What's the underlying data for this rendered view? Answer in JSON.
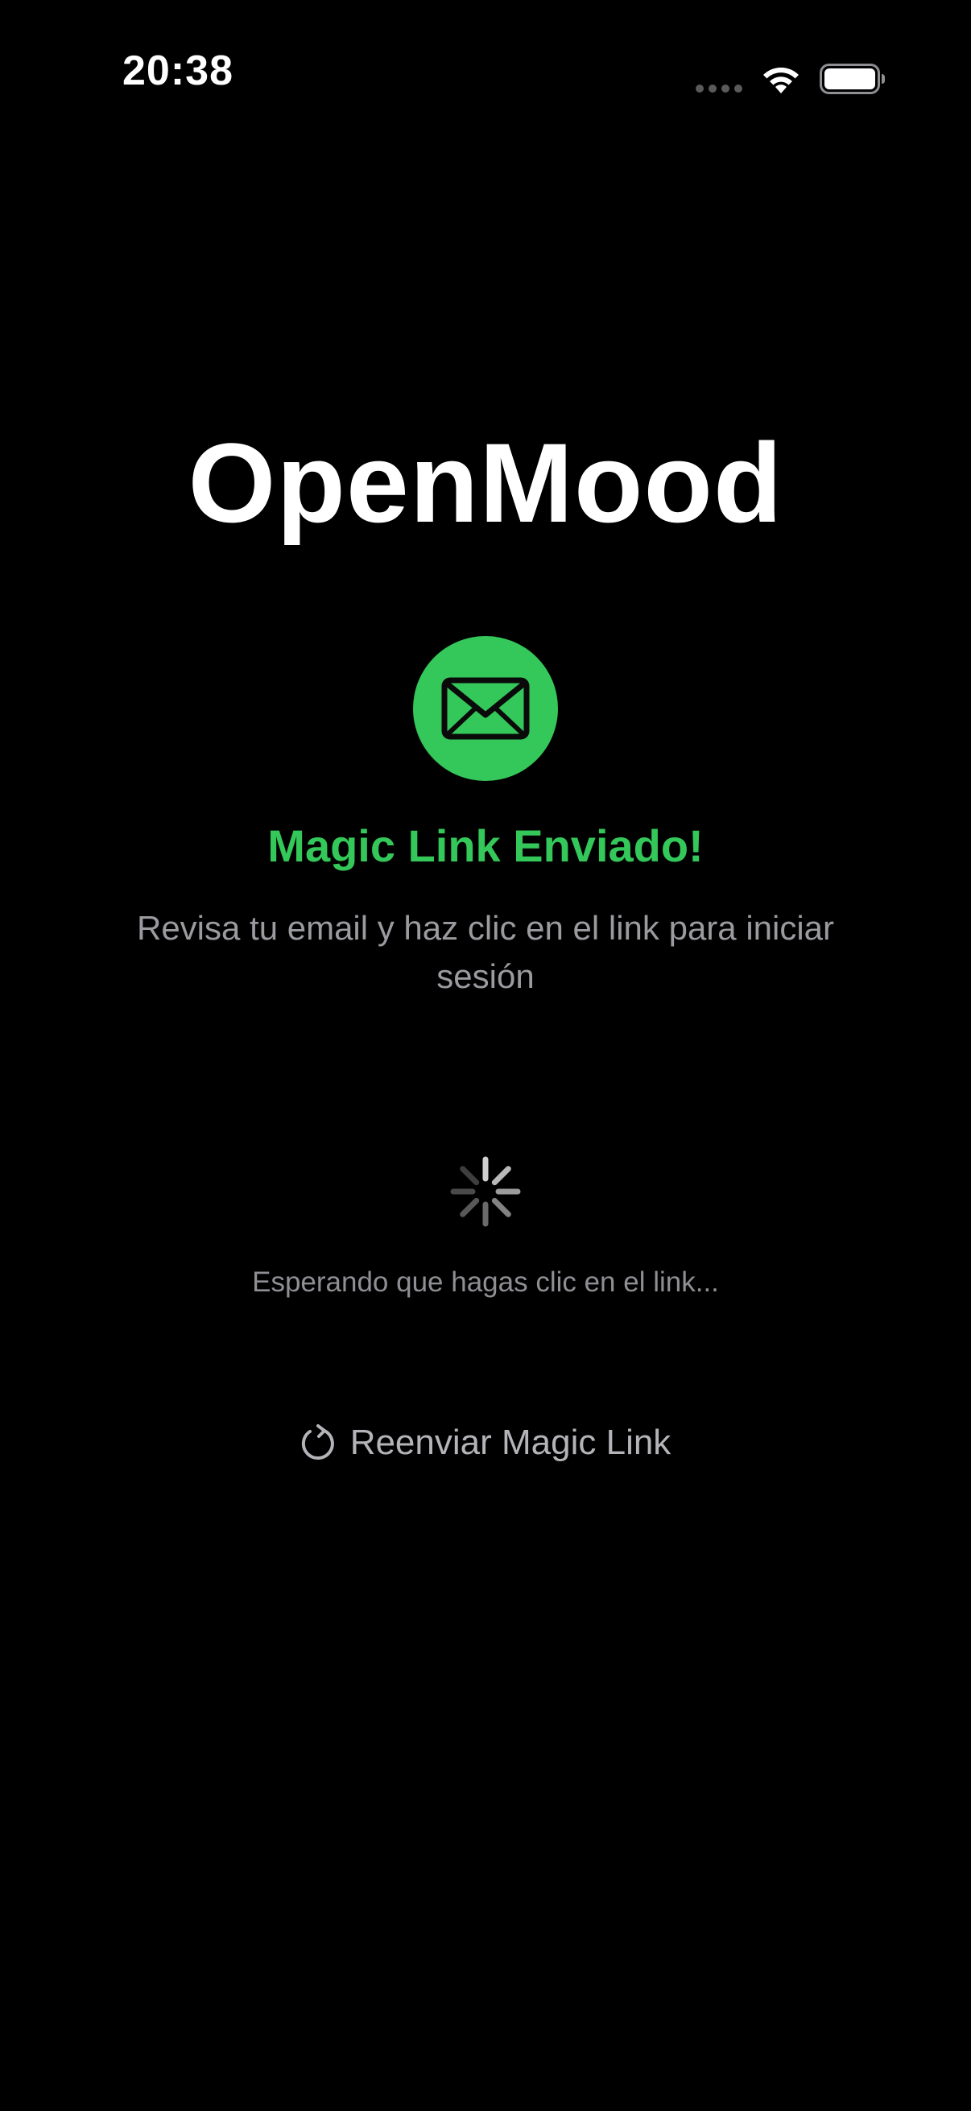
{
  "status_bar": {
    "time": "20:38",
    "icons": [
      "cellular-signal-icon",
      "wifi-icon",
      "battery-icon"
    ]
  },
  "app": {
    "title": "OpenMood"
  },
  "confirmation": {
    "icon": "envelope-icon",
    "heading": "Magic Link Enviado!",
    "message": "Revisa tu email y haz clic en el link para iniciar sesión"
  },
  "waiting": {
    "icon": "activity-spinner-icon",
    "text": "Esperando que hagas clic en el link..."
  },
  "resend": {
    "icon": "refresh-icon",
    "label": "Reenviar Magic Link"
  },
  "colors": {
    "background": "#000000",
    "accent_green": "#34c759",
    "secondary_text": "#9a9a9f"
  }
}
